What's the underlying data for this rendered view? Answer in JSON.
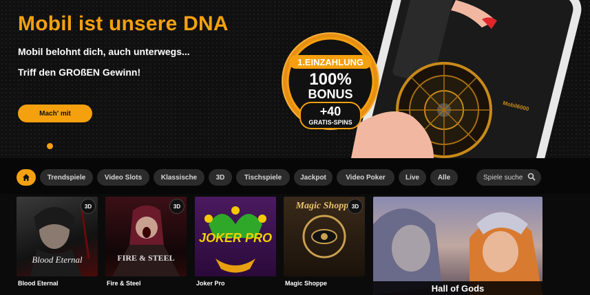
{
  "hero": {
    "title": "Mobil ist unsere DNA",
    "subtitle": "Mobil belohnt dich, auch unterwegs...",
    "tagline": "Triff den GROßEN Gewinn!",
    "cta_label": "Mach' mit",
    "badge": {
      "line1": "1.EINZAHLUNG",
      "line2": "100%",
      "line3": "BONUS",
      "line4": "+40",
      "line5": "GRATIS-SPINS"
    },
    "phone_brand": "Mobil6000"
  },
  "nav": {
    "categories": [
      "Trendspiele",
      "Video Slots",
      "Klassische",
      "3D",
      "Tischspiele",
      "Jackpot",
      "Video Poker",
      "Live",
      "Alle"
    ],
    "search_placeholder": "Spiele suche"
  },
  "games": [
    {
      "name": "Blood Eternal",
      "badge": "3D",
      "logo": "Blood Eternal"
    },
    {
      "name": "Fire & Steel",
      "badge": "3D",
      "logo": "FIRE & STEEL"
    },
    {
      "name": "Joker Pro",
      "badge": "",
      "logo": "JOKER PRO"
    },
    {
      "name": "Magic Shoppe",
      "badge": "3D",
      "logo": "Magic Shoppe"
    }
  ],
  "featured_game": {
    "name": "Hall of Gods"
  },
  "colors": {
    "accent": "#f5a00f",
    "background": "#0b0b0b",
    "chip": "#2b2b2b"
  }
}
